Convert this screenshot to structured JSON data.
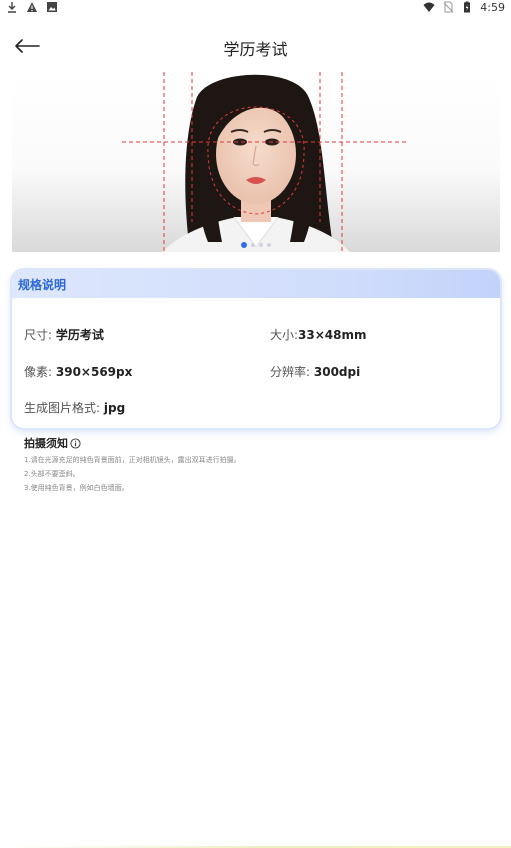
{
  "status_bar": {
    "time": "4:59",
    "icons_left": [
      "download-icon",
      "warning-icon",
      "image-icon"
    ],
    "icons_right": [
      "wifi-icon",
      "no-sim-icon",
      "battery-icon"
    ]
  },
  "header": {
    "title": "学历考试",
    "back_icon": "arrow-left-icon"
  },
  "banner": {
    "image": "sample-portrait-photo-with-guide-lines",
    "page_count": 4,
    "active_index": 0,
    "guide_line_color": "#e03a3a"
  },
  "spec": {
    "title": "规格说明",
    "size_label": "尺寸:",
    "size_value": "学历考试",
    "dims_label": "大小:",
    "dims_value": "33×48mm",
    "pixel_label": "像素:",
    "pixel_value": "390×569px",
    "dpi_label": "分辨率:",
    "dpi_value": "300dpi",
    "format_label": "生成图片格式:",
    "format_value": "jpg"
  },
  "notes": {
    "title": "拍摄须知",
    "items": [
      "1.请在光源充足的纯色背景面前，正对相机镜头，露出双耳进行拍摄。",
      "2.头部不要歪斜。",
      "3.使用纯色背景，例如白色墙面。"
    ]
  },
  "colors": {
    "accent": "#2b67d6",
    "card_header": "#d4e0fc",
    "dot_active": "#2f6fe6"
  }
}
